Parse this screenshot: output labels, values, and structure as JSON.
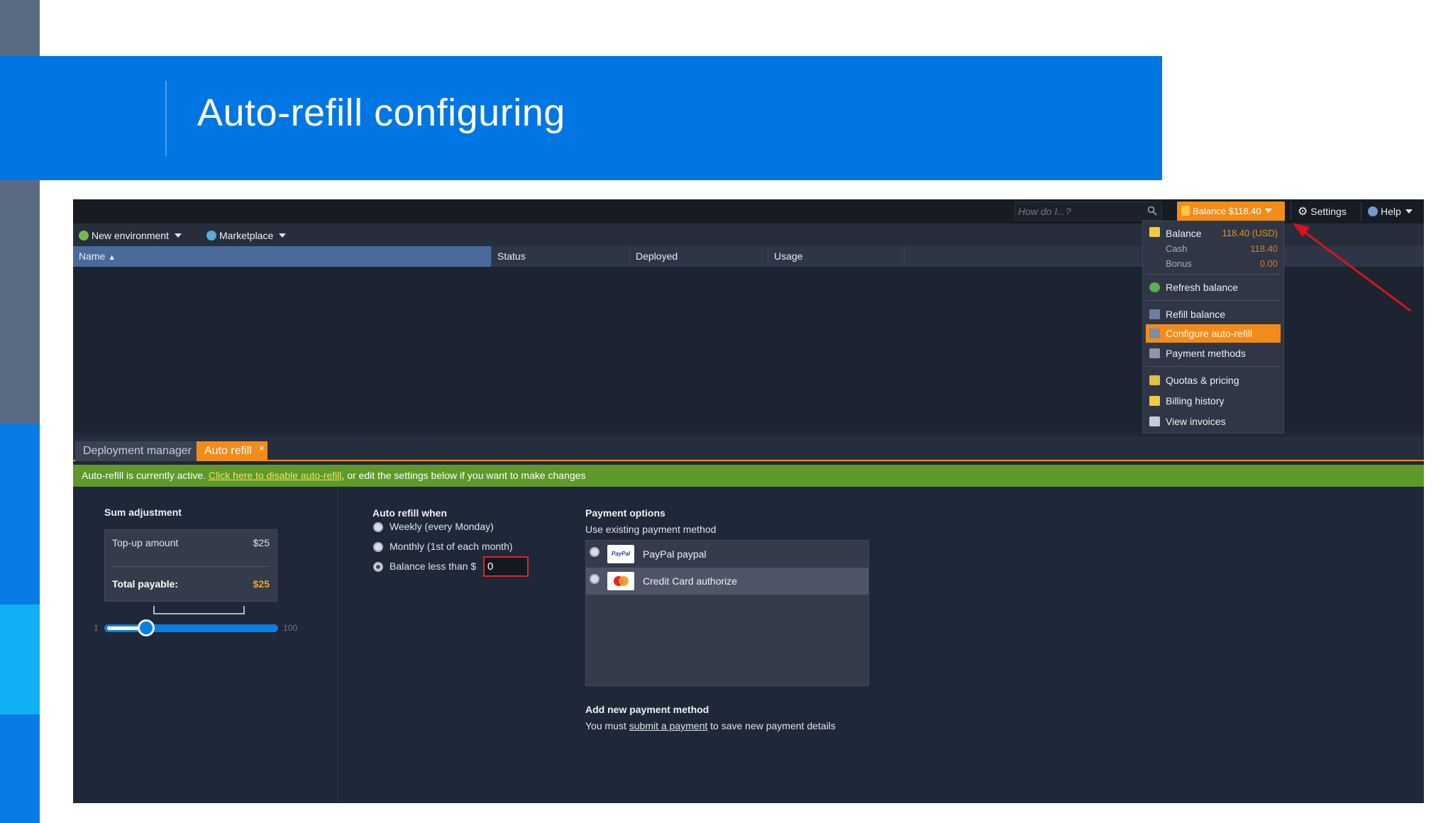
{
  "slide": {
    "title": "Auto-refill configuring"
  },
  "topbar": {
    "search_placeholder": "How do I...?",
    "balance_button": "Balance $118.40",
    "settings": "Settings",
    "help": "Help"
  },
  "toolbar": {
    "new_environment": "New environment",
    "marketplace": "Marketplace"
  },
  "grid": {
    "columns": [
      "Name",
      "Status",
      "Deployed",
      "Usage"
    ]
  },
  "balance_menu": {
    "balance_label": "Balance",
    "balance_value": "118.40 (USD)",
    "cash_label": "Cash",
    "cash_value": "118.40",
    "bonus_label": "Bonus",
    "bonus_value": "0.00",
    "items": [
      "Refresh balance",
      "Refill balance",
      "Configure auto-refill",
      "Payment methods",
      "Quotas & pricing",
      "Billing history",
      "View invoices"
    ]
  },
  "tabs": {
    "deployment_manager": "Deployment manager",
    "auto_refill": "Auto refill",
    "close": "×"
  },
  "notice": {
    "before": "Auto-refill is currently active. ",
    "link": "Click here to disable auto-refill",
    "after": ", or edit the settings below if you want to make changes"
  },
  "sum": {
    "heading": "Sum adjustment",
    "topup_label": "Top-up amount",
    "topup_value": "$25",
    "total_label": "Total payable:",
    "total_value": "$25",
    "slider_min": "1",
    "slider_max": "100",
    "slider_value": 25
  },
  "refill_when": {
    "heading": "Auto refill when",
    "options": [
      "Weekly (every Monday)",
      "Monthly (1st of each month)",
      "Balance less than $"
    ],
    "selected": 2,
    "threshold": "0"
  },
  "payment": {
    "heading": "Payment options",
    "sub": "Use existing payment method",
    "methods": [
      "PayPal paypal",
      "Credit Card authorize"
    ],
    "new_heading": "Add new payment method",
    "new_before": "You must ",
    "new_link": "submit a payment",
    "new_after": " to save new payment details"
  },
  "colors": {
    "accent": "#f18c1b",
    "brand_blue": "#0076e3",
    "notice_green": "#5e9a2a"
  }
}
